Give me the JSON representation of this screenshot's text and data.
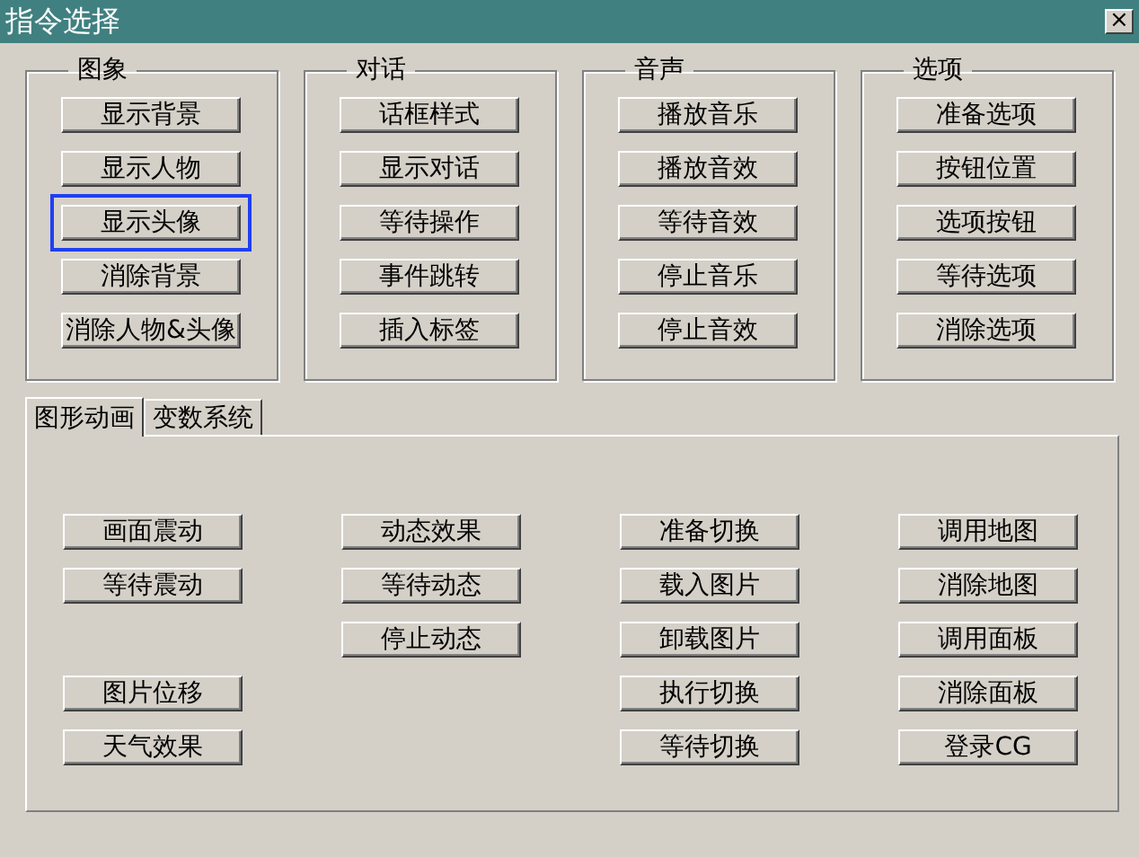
{
  "window": {
    "title": "指令选择",
    "close": "×"
  },
  "groups": [
    {
      "title": "图象",
      "buttons": [
        {
          "label": "显示背景",
          "focused": false
        },
        {
          "label": "显示人物",
          "focused": false
        },
        {
          "label": "显示头像",
          "focused": true
        },
        {
          "label": "消除背景",
          "focused": false
        },
        {
          "label": "消除人物&头像",
          "focused": false
        }
      ]
    },
    {
      "title": "对话",
      "buttons": [
        {
          "label": "话框样式",
          "focused": false
        },
        {
          "label": "显示对话",
          "focused": false
        },
        {
          "label": "等待操作",
          "focused": false
        },
        {
          "label": "事件跳转",
          "focused": false
        },
        {
          "label": "插入标签",
          "focused": false
        }
      ]
    },
    {
      "title": "音声",
      "buttons": [
        {
          "label": "播放音乐",
          "focused": false
        },
        {
          "label": "播放音效",
          "focused": false
        },
        {
          "label": "等待音效",
          "focused": false
        },
        {
          "label": "停止音乐",
          "focused": false
        },
        {
          "label": "停止音效",
          "focused": false
        }
      ]
    },
    {
      "title": "选项",
      "buttons": [
        {
          "label": "准备选项",
          "focused": false
        },
        {
          "label": "按钮位置",
          "focused": false
        },
        {
          "label": "选项按钮",
          "focused": false
        },
        {
          "label": "等待选项",
          "focused": false
        },
        {
          "label": "消除选项",
          "focused": false
        }
      ]
    }
  ],
  "tabs": [
    {
      "label": "图形动画",
      "selected": true
    },
    {
      "label": "变数系统",
      "selected": false
    }
  ],
  "tab_columns": [
    [
      {
        "kind": "button",
        "label": "画面震动"
      },
      {
        "kind": "button",
        "label": "等待震动"
      },
      {
        "kind": "blank"
      },
      {
        "kind": "button",
        "label": "图片位移"
      },
      {
        "kind": "button",
        "label": "天气效果"
      }
    ],
    [
      {
        "kind": "button",
        "label": "动态效果"
      },
      {
        "kind": "button",
        "label": "等待动态"
      },
      {
        "kind": "button",
        "label": "停止动态"
      }
    ],
    [
      {
        "kind": "button",
        "label": "准备切换"
      },
      {
        "kind": "button",
        "label": "载入图片"
      },
      {
        "kind": "button",
        "label": "卸载图片"
      },
      {
        "kind": "button",
        "label": "执行切换"
      },
      {
        "kind": "button",
        "label": "等待切换"
      }
    ],
    [
      {
        "kind": "button",
        "label": "调用地图"
      },
      {
        "kind": "button",
        "label": "消除地图"
      },
      {
        "kind": "button",
        "label": "调用面板"
      },
      {
        "kind": "button",
        "label": "消除面板"
      },
      {
        "kind": "button",
        "label": "登录CG"
      }
    ]
  ]
}
